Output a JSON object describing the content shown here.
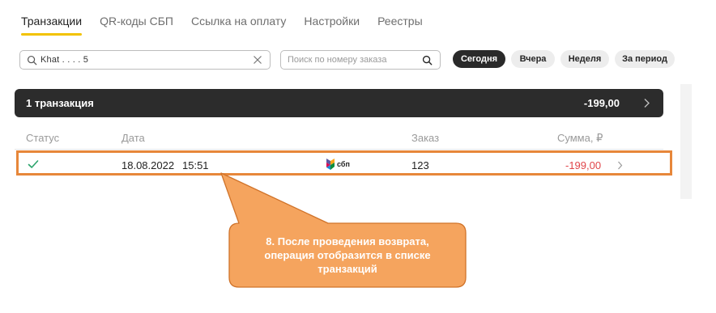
{
  "tabs": [
    {
      "label": "Транзакции",
      "active": true
    },
    {
      "label": "QR-коды СБП",
      "active": false
    },
    {
      "label": "Ссылка на оплату",
      "active": false
    },
    {
      "label": "Настройки",
      "active": false
    },
    {
      "label": "Реестры",
      "active": false
    }
  ],
  "search": {
    "value": "Khat          .          .          .          .          5",
    "order_placeholder": "Поиск по номеру заказа"
  },
  "filters": [
    "Сегодня",
    "Вчера",
    "Неделя",
    "За период"
  ],
  "active_filter": "Сегодня",
  "summary": {
    "count": "1 транзакция",
    "total": "-199,00"
  },
  "columns": {
    "status": "Статус",
    "date": "Дата",
    "order": "Заказ",
    "amount": "Сумма, ₽"
  },
  "row": {
    "status": "success",
    "date": "18.08.2022",
    "time": "15:51",
    "method": "сбп",
    "order": "123",
    "amount": "-199,00"
  },
  "callout": {
    "line1": "8. После проведения возврата,",
    "line2": "операция отобразится в списке",
    "line3": "транзакций"
  },
  "colors": {
    "accent": "#f2c200",
    "dark": "#2c2c2c",
    "negative": "#e0454a",
    "success": "#2aa36b",
    "annotation": "#f5a45e"
  },
  "icons": {
    "search": "magnifier",
    "clear": "x",
    "chevron": "chevron-right",
    "status": "check",
    "payment": "sbp-logo"
  }
}
